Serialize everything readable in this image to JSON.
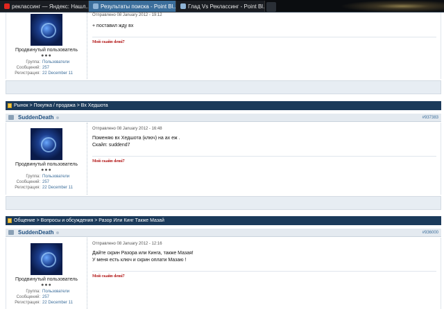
{
  "browser": {
    "tabs": [
      {
        "label": "реклассинг — Яндекс: Нашл...",
        "active": false,
        "icon": "yandex-icon"
      },
      {
        "label": "Результаты поиска - Point Bl...",
        "active": true,
        "icon": "page-icon"
      },
      {
        "label": "Глад Vs Реклассинг - Point Bl...",
        "active": false,
        "icon": "page-icon"
      }
    ]
  },
  "posts": [
    {
      "breadcrumb": "",
      "author": "",
      "post_number": "",
      "meta": "Отправлено 08 January 2012 - 19:12",
      "message": [
        "+ поставил жду вх"
      ],
      "rank": "Продвинутый пользователь",
      "pips": "●●●",
      "stats": [
        {
          "k": "Группа:",
          "v": "Пользователи"
        },
        {
          "k": "Сообщений:",
          "v": "257"
        },
        {
          "k": "Регистрация:",
          "v": "22 December 11"
        }
      ],
      "signature": "Мой скайп demi7"
    },
    {
      "breadcrumb": "Рынок > Покупка / продажа > Вх Хедшота",
      "author": "SuddenDeath",
      "post_number": "#937383",
      "meta": "Отправлено 08 January 2012 - 16:48",
      "message": [
        "Поменяю вх Хедшота (ключ) на ах еж .",
        "Скайп: suddend7"
      ],
      "rank": "Продвинутый пользователь",
      "pips": "●●●",
      "stats": [
        {
          "k": "Группа:",
          "v": "Пользователи"
        },
        {
          "k": "Сообщений:",
          "v": "257"
        },
        {
          "k": "Регистрация:",
          "v": "22 December 11"
        }
      ],
      "signature": "Мой скайп demi7"
    },
    {
      "breadcrumb": "Общение > Вопросы и обсуждения > Разор Или Кинг Также Мазай",
      "author": "SuddenDeath",
      "post_number": "#936000",
      "meta": "Отправлено 08 January 2012 - 12:16",
      "message": [
        "Дайте скрин Разора или Кинга, также Мазая!",
        "У меня есть ключ и скрин оплати Мазаю !"
      ],
      "rank": "Продвинутый пользователь",
      "pips": "●●●",
      "stats": [
        {
          "k": "Группа:",
          "v": "Пользователи"
        },
        {
          "k": "Сообщений:",
          "v": "257"
        },
        {
          "k": "Регистрация:",
          "v": "22 December 11"
        }
      ],
      "signature": "Мой скайп demi7"
    }
  ]
}
